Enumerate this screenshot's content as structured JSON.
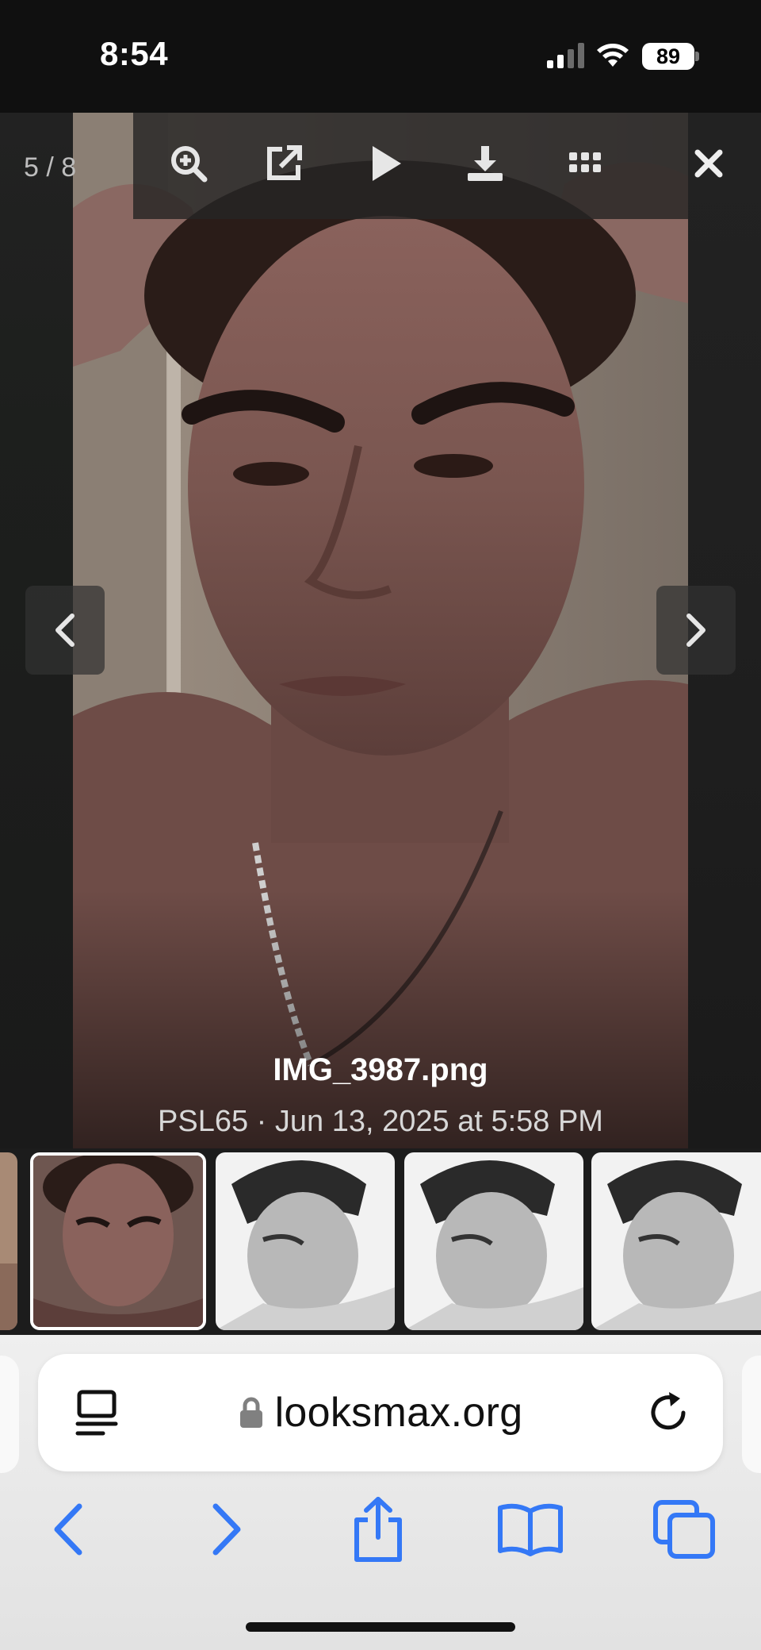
{
  "status_bar": {
    "time": "8:54",
    "battery": "89"
  },
  "viewer": {
    "counter": "5 / 8",
    "caption": {
      "filename": "IMG_3987.png",
      "meta": "PSL65 · Jun 13, 2025 at 5:58 PM"
    },
    "toolbar": [
      "zoom-icon",
      "open-external-icon",
      "play-icon",
      "download-icon",
      "grid-icon",
      "close-icon"
    ]
  },
  "filmstrip": {
    "thumbnails": [
      "thumb-prev",
      "thumb-current",
      "thumb-bw-1",
      "thumb-bw-2",
      "thumb-bw-3"
    ],
    "active_index": 1
  },
  "browser": {
    "url": "looksmax.org",
    "accent_color": "#3478f6"
  }
}
